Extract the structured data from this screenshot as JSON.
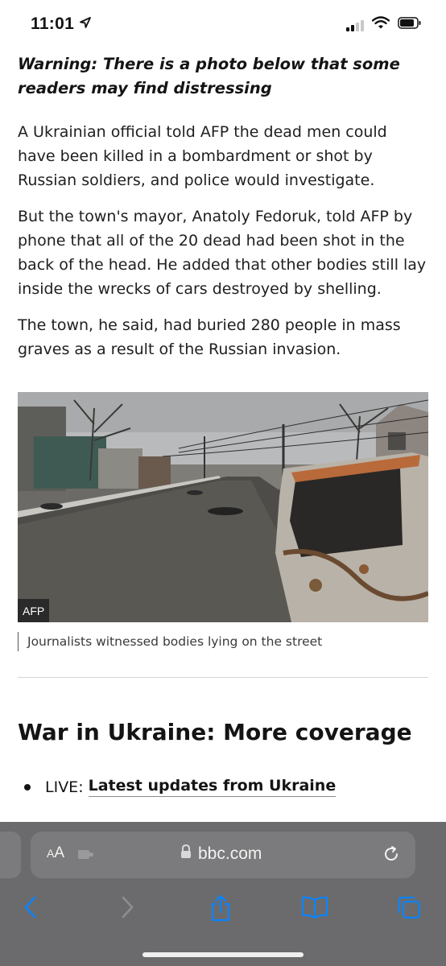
{
  "status_bar": {
    "time": "11:01",
    "location_icon": "location-arrow-icon",
    "signal_icon": "cellular-signal-icon",
    "wifi_icon": "wifi-icon",
    "battery_icon": "battery-icon"
  },
  "article": {
    "warning": "Warning: There is a photo below that some readers may find distressing",
    "paragraphs": [
      "A Ukrainian official told AFP the dead men could have been killed in a bombardment or shot by Russian soldiers, and police would investigate.",
      "But the town's mayor, Anatoly Fedoruk, told AFP by phone that all of the 20 dead had been shot in the back of the head. He added that other bodies still lay inside the wrecks of cars destroyed by shelling.",
      "The town, he said, had buried 280 people in mass graves as a result of the Russian invasion."
    ],
    "photo_credit": "AFP",
    "photo_caption": "Journalists witnessed bodies lying on the street",
    "section_heading": "War in Ukraine: More coverage",
    "live_prefix": "LIVE:",
    "live_link": "Latest updates from Ukraine"
  },
  "browser": {
    "text_size_label_big": "A",
    "text_size_label_small": "A",
    "domain": "bbc.com",
    "icons": {
      "extension": "puzzle-icon",
      "lock": "lock-icon",
      "reload": "reload-icon",
      "back": "back-chevron-icon",
      "forward": "forward-chevron-icon",
      "share": "share-icon",
      "bookmarks": "bookmarks-icon",
      "tabs": "tabs-icon"
    }
  },
  "colors": {
    "text": "#141414",
    "browser_bar": "#6b6b6d",
    "toolbar_icon": "#0a84ff"
  }
}
